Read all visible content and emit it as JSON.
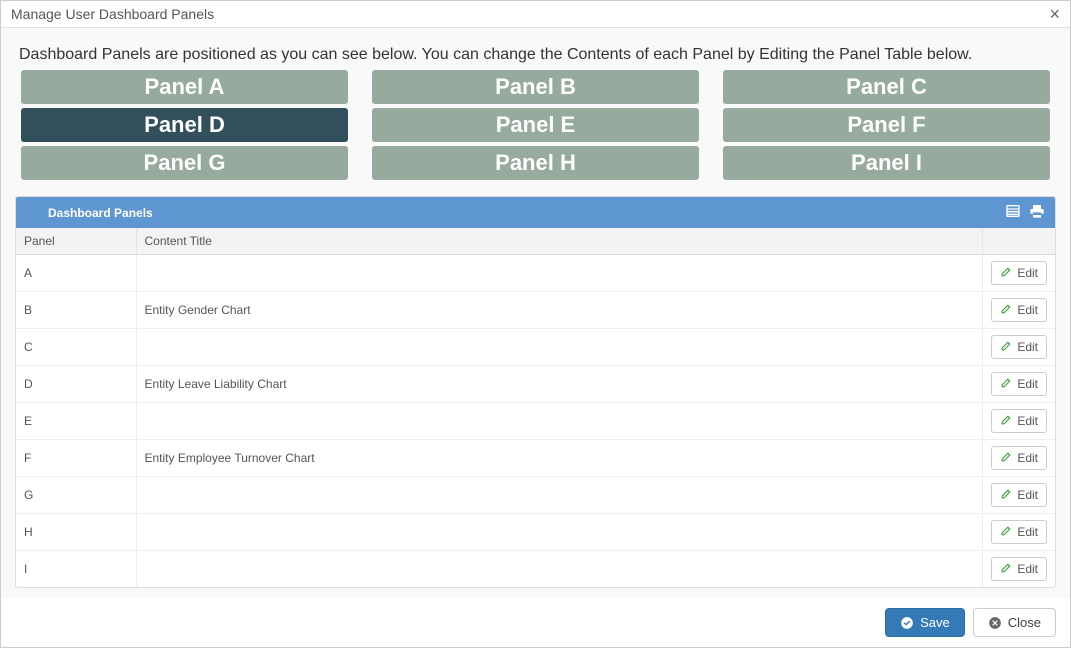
{
  "modal": {
    "title": "Manage User Dashboard Panels",
    "close_label": "×"
  },
  "intro": "Dashboard Panels are positioned as you can see below. You can change the Contents of each Panel by Editing the Panel Table below.",
  "panels": {
    "rows": [
      [
        {
          "label": "Panel A",
          "active": false
        },
        {
          "label": "Panel B",
          "active": false
        },
        {
          "label": "Panel C",
          "active": false
        }
      ],
      [
        {
          "label": "Panel D",
          "active": true
        },
        {
          "label": "Panel E",
          "active": false
        },
        {
          "label": "Panel F",
          "active": false
        }
      ],
      [
        {
          "label": "Panel G",
          "active": false
        },
        {
          "label": "Panel H",
          "active": false
        },
        {
          "label": "Panel I",
          "active": false
        }
      ]
    ]
  },
  "table": {
    "card_title": "Dashboard Panels",
    "columns": {
      "panel": "Panel",
      "content_title": "Content Title"
    },
    "edit_label": "Edit",
    "rows": [
      {
        "panel": "A",
        "content_title": ""
      },
      {
        "panel": "B",
        "content_title": "Entity Gender Chart"
      },
      {
        "panel": "C",
        "content_title": ""
      },
      {
        "panel": "D",
        "content_title": "Entity Leave Liability Chart"
      },
      {
        "panel": "E",
        "content_title": ""
      },
      {
        "panel": "F",
        "content_title": "Entity Employee Turnover Chart"
      },
      {
        "panel": "G",
        "content_title": ""
      },
      {
        "panel": "H",
        "content_title": ""
      },
      {
        "panel": "I",
        "content_title": ""
      }
    ]
  },
  "footer": {
    "save_label": "Save",
    "close_label": "Close"
  }
}
